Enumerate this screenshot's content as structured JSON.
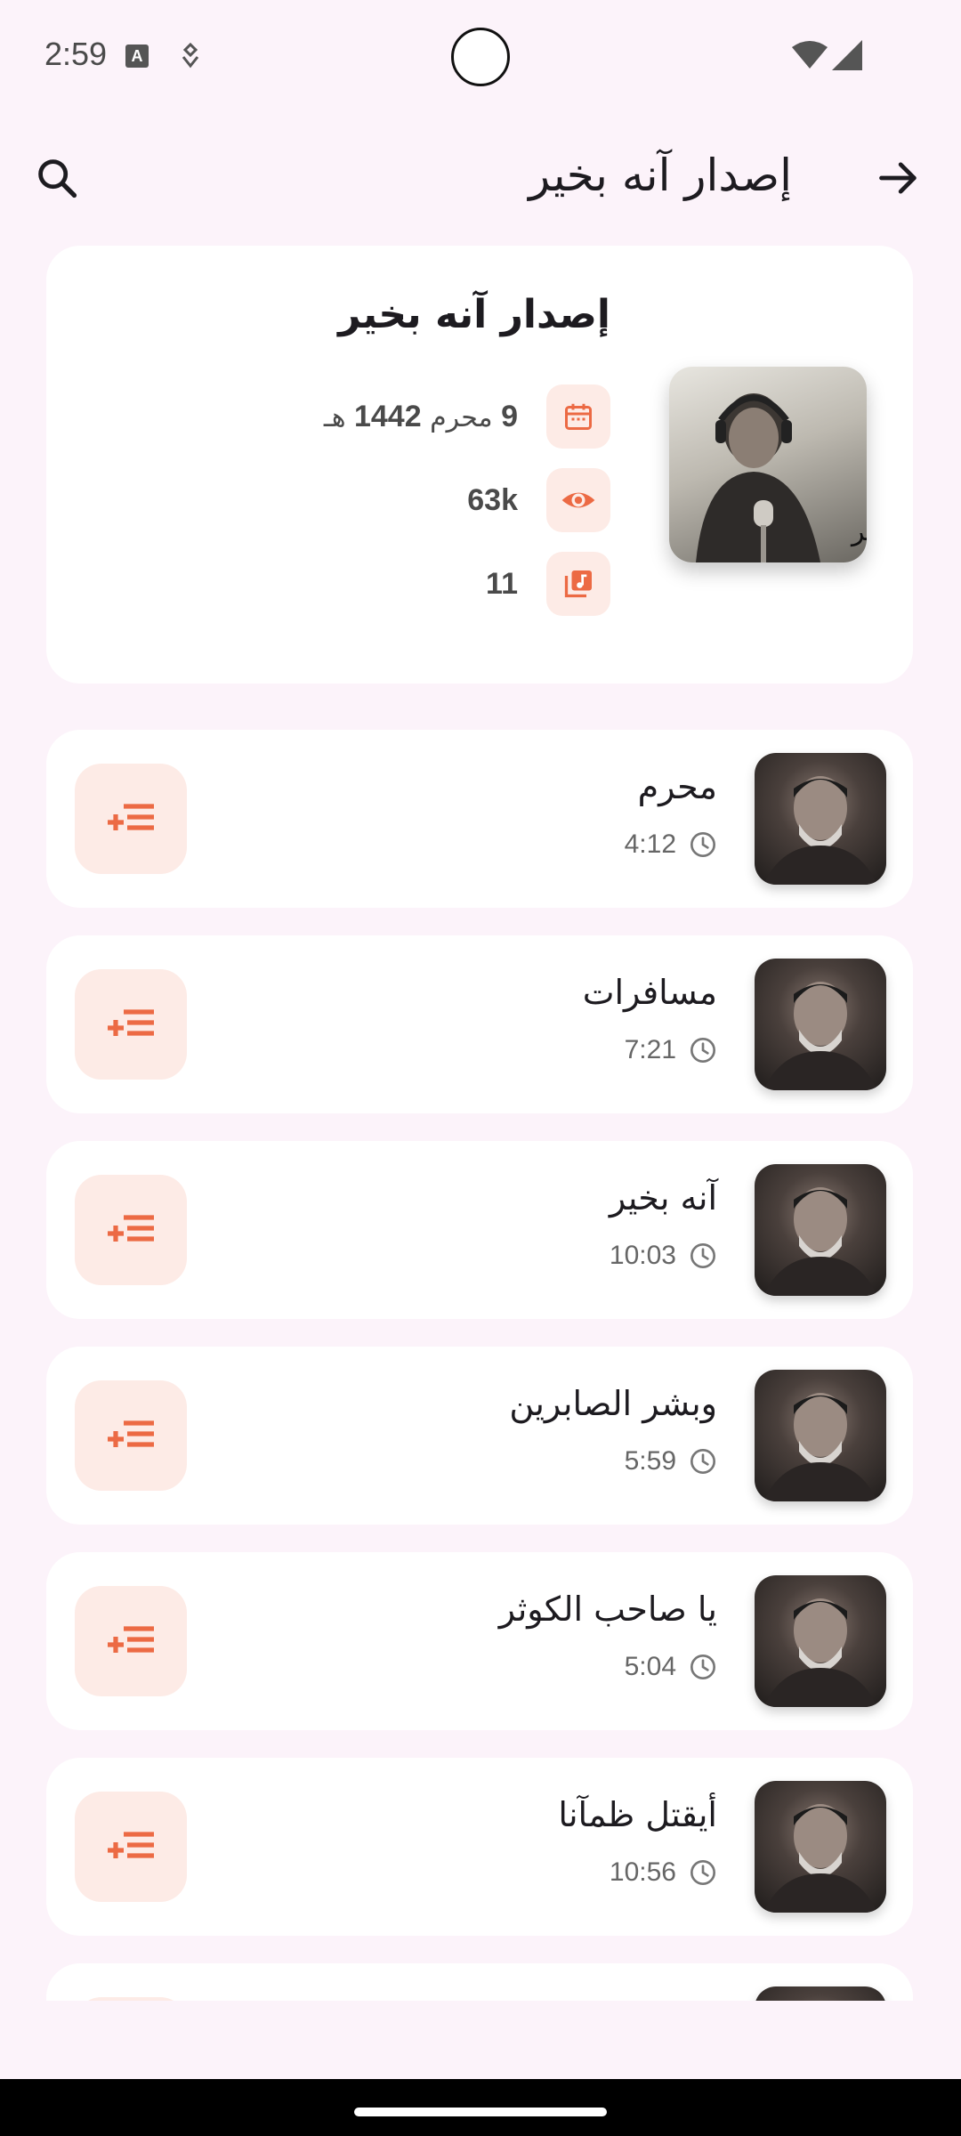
{
  "status_bar": {
    "time": "2:59",
    "icon_a": "A"
  },
  "app_bar": {
    "title": "إصدار آنه بخير"
  },
  "header": {
    "title": "إصدار آنه بخير",
    "date_day": "9",
    "date_month": "محرم",
    "date_year": "1442",
    "date_suffix": "هـ",
    "views": "63k",
    "tracks_count": "11",
    "album_art_text": "آنه بخير"
  },
  "tracks": [
    {
      "name": "محرم",
      "duration": "4:12"
    },
    {
      "name": "مسافرات",
      "duration": "7:21"
    },
    {
      "name": "آنه بخير",
      "duration": "10:03"
    },
    {
      "name": "وبشر الصابرين",
      "duration": "5:59"
    },
    {
      "name": "يا صاحب الكوثر",
      "duration": "5:04"
    },
    {
      "name": "أيقتل ظمآنا",
      "duration": "10:56"
    }
  ],
  "colors": {
    "accent": "#ec6a44",
    "accent_bg": "#fdebe6",
    "background": "#fcf3fa"
  }
}
